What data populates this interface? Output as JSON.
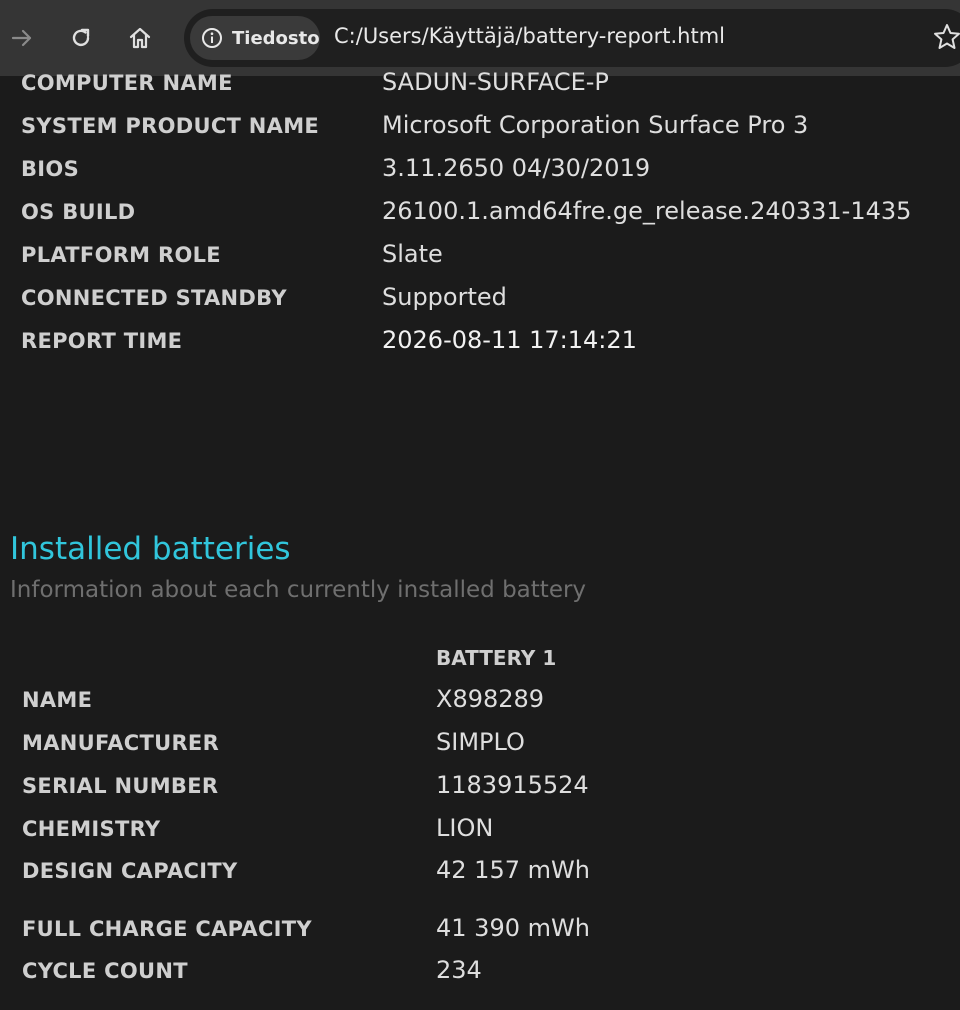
{
  "browser": {
    "security_chip_label": "Tiedosto",
    "url": "C:/Users/Käyttäjä/battery-report.html",
    "icons": [
      "forward-icon",
      "reload-icon",
      "home-icon",
      "info-icon",
      "bookmark-star-icon"
    ]
  },
  "system_info": {
    "rows": [
      {
        "label": "COMPUTER NAME",
        "value": "SADUN-SURFACE-P"
      },
      {
        "label": "SYSTEM PRODUCT NAME",
        "value": "Microsoft Corporation Surface Pro 3"
      },
      {
        "label": "BIOS",
        "value": "3.11.2650 04/30/2019"
      },
      {
        "label": "OS BUILD",
        "value": "26100.1.amd64fre.ge_release.240331-1435"
      },
      {
        "label": "PLATFORM ROLE",
        "value": "Slate"
      },
      {
        "label": "CONNECTED STANDBY",
        "value": "Supported"
      },
      {
        "label": "REPORT TIME",
        "value": "2026-08-11  17:14:21"
      }
    ]
  },
  "batteries": {
    "title": "Installed batteries",
    "subtitle": "Information about each currently installed battery",
    "column_header": "BATTERY 1",
    "rows": [
      {
        "label": "NAME",
        "value": "X898289"
      },
      {
        "label": "MANUFACTURER",
        "value": "SIMPLO"
      },
      {
        "label": "SERIAL NUMBER",
        "value": "1183915524"
      },
      {
        "label": "CHEMISTRY",
        "value": "LION"
      },
      {
        "label": "DESIGN CAPACITY",
        "value": "42 157 mWh"
      },
      {
        "label": "FULL CHARGE CAPACITY",
        "value": "41 390 mWh"
      },
      {
        "label": "CYCLE COUNT",
        "value": "234"
      }
    ]
  },
  "colors": {
    "toolbar": "#353535",
    "page_background": "#1b1b1b",
    "accent_title": "#31c6dc"
  }
}
